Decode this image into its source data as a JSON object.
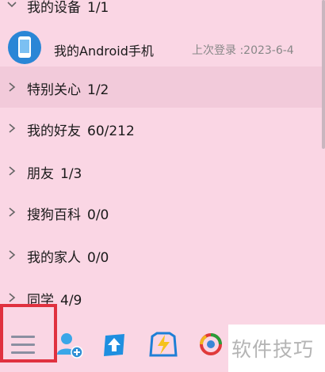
{
  "groups": [
    {
      "label": "我的设备",
      "count": "1/1",
      "expanded": true
    },
    {
      "label": "特别关心",
      "count": "1/2",
      "expanded": false
    },
    {
      "label": "我的好友",
      "count": "60/212",
      "expanded": false
    },
    {
      "label": "朋友",
      "count": "1/3",
      "expanded": false
    },
    {
      "label": "搜狗百科",
      "count": "0/0",
      "expanded": false
    },
    {
      "label": "我的家人",
      "count": "0/0",
      "expanded": false
    },
    {
      "label": "同学",
      "count": "4/9",
      "expanded": false
    }
  ],
  "device": {
    "name": "我的Android手机",
    "last_login": "上次登录 :2023-6-4"
  },
  "toolbar": {
    "icons": [
      "menu-icon",
      "add-contact-icon",
      "arrow-up-app-icon",
      "lightning-app-icon",
      "browser-app-icon"
    ]
  },
  "watermark": "软件技巧",
  "colors": {
    "background": "#fad6e4",
    "highlight": "#f2cada",
    "accent_red": "#e0313f",
    "icon_blue": "#2a86d6"
  }
}
